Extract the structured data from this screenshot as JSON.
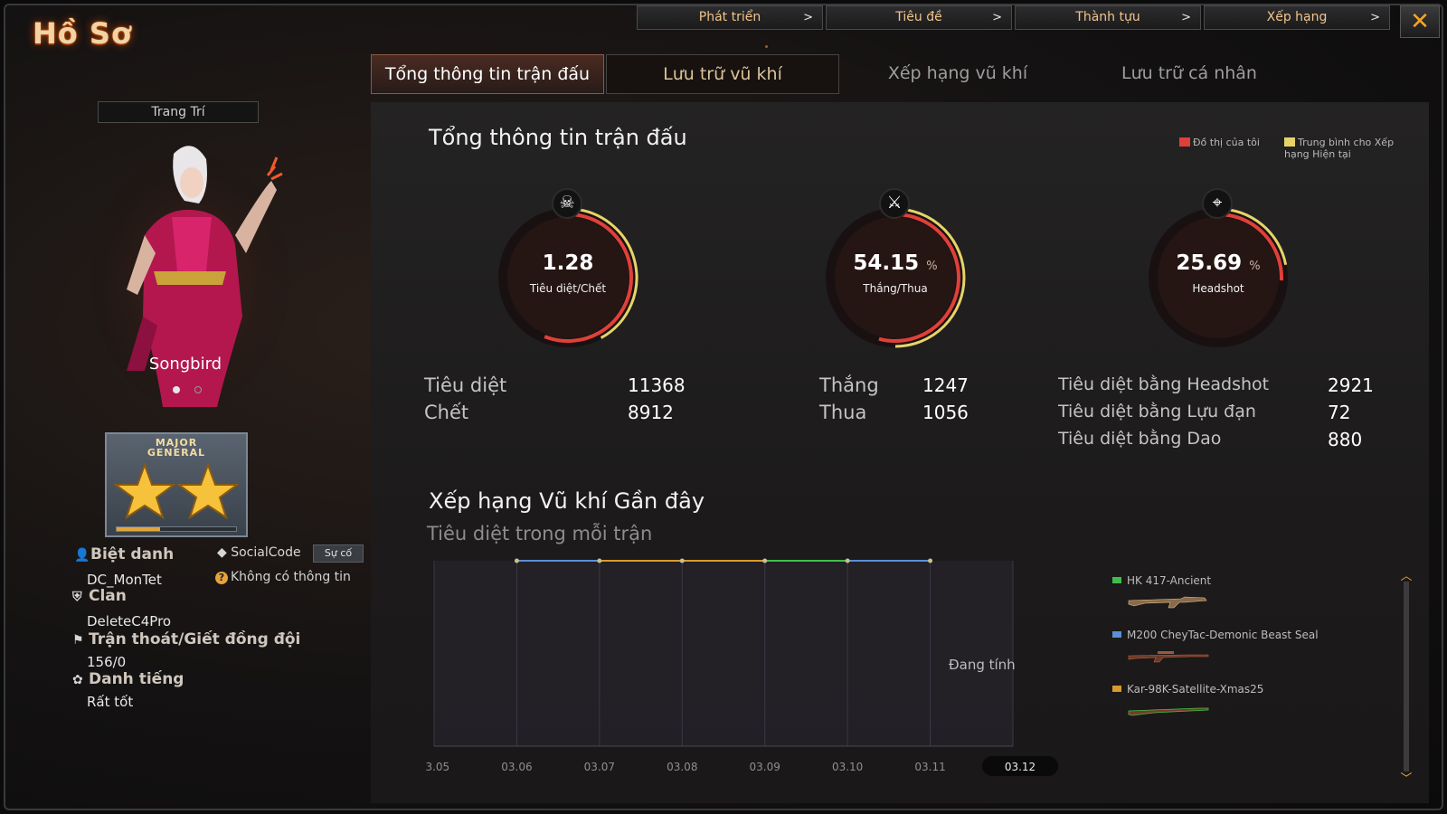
{
  "app": {
    "title": "Hồ Sơ"
  },
  "top_nav": [
    {
      "label": "Phát triển",
      "chevron": ">"
    },
    {
      "label": "Tiêu đề",
      "chevron": ">"
    },
    {
      "label": "Thành tựu",
      "chevron": ">"
    },
    {
      "label": "Xếp hạng",
      "chevron": ">"
    }
  ],
  "close_glyph": "✕",
  "tabs": [
    {
      "label": "Tổng thông tin trận đấu",
      "active": true
    },
    {
      "label": "Lưu trữ vũ khí",
      "active": false
    },
    {
      "label": "Xếp hạng vũ khí",
      "active": false
    },
    {
      "label": "Lưu trữ cá nhân",
      "active": false
    }
  ],
  "profile": {
    "decorate_label": "Trang Trí",
    "character_name": "Songbird",
    "rank_title": "MAJOR\nGENERAL",
    "rank_stars": 2,
    "rank_progress": 0.36,
    "nickname_label": "Biệt danh",
    "nickname": "DC_MonTet",
    "socialcode_label": "SocialCode",
    "incident_label": "Sự cố",
    "no_info_label": "Không có thông tin",
    "clan_label": "Clan",
    "clan": "DeleteC4Pro",
    "escape_label": "Trận thoát/Giết đồng đội",
    "escape_value": "156/0",
    "reputation_label": "Danh tiếng",
    "reputation_value": "Rất tốt"
  },
  "overview": {
    "title": "Tổng thông tin trận đấu",
    "legend_mine": "Đồ thị của tôi",
    "legend_avg": "Trung bình cho Xếp hạng Hiện tại",
    "legend_colors": {
      "mine": "#e0403a",
      "avg": "#e6d46a"
    },
    "gauges": [
      {
        "icon": "☠",
        "value": "1.28",
        "unit": "",
        "label": "Tiêu diệt/Chết",
        "mine_fraction": 0.56,
        "avg_fraction": 0.42
      },
      {
        "icon": "⚔",
        "value": "54.15",
        "unit": "%",
        "label": "Thắng/Thua",
        "mine_fraction": 0.5415,
        "avg_fraction": 0.5
      },
      {
        "icon": "⌖",
        "value": "25.69",
        "unit": "%",
        "label": "Headshot",
        "mine_fraction": 0.2569,
        "avg_fraction": 0.22
      }
    ],
    "stats": [
      {
        "label": "Tiêu diệt",
        "value": "11368"
      },
      {
        "label": "Chết",
        "value": "8912"
      },
      {
        "label": "Thắng",
        "value": "1247"
      },
      {
        "label": "Thua",
        "value": "1056"
      },
      {
        "label": "Tiêu diệt bằng Headshot",
        "value": "2921"
      },
      {
        "label": "Tiêu diệt bằng Lựu đạn",
        "value": "72"
      },
      {
        "label": "Tiêu diệt bằng Dao",
        "value": "880"
      }
    ]
  },
  "weapon_ranking": {
    "title": "Xếp hạng Vũ khí Gần đây",
    "subtitle": "Tiêu diệt trong mỗi trận",
    "calculating_label": "Đang tính",
    "weapons": [
      {
        "name": "HK 417-Ancient",
        "color": "#3fbf4a"
      },
      {
        "name": "M200 CheyTac-Demonic Beast Seal",
        "color": "#5a8fd8"
      },
      {
        "name": "Kar-98K-Satellite-Xmas25",
        "color": "#d99a2b"
      }
    ]
  },
  "chart_data": {
    "type": "line",
    "title": "Xếp hạng Vũ khí Gần đây",
    "ylabel": "Tiêu diệt trong mỗi trận",
    "categories": [
      "03.05",
      "03.06",
      "03.07",
      "03.08",
      "03.09",
      "03.10",
      "03.11",
      "03.12"
    ],
    "selected_category": "03.12",
    "series": [
      {
        "name": "HK 417-Ancient",
        "color": "#3fbf4a",
        "points": [
          [
            1,
            1
          ],
          [
            2,
            1
          ],
          [
            3,
            1
          ],
          [
            4,
            1
          ],
          [
            5,
            1
          ],
          [
            6,
            1
          ]
        ]
      },
      {
        "name": "M200 CheyTac-Demonic Beast Seal",
        "color": "#5a8fd8",
        "points": [
          [
            1,
            1
          ],
          [
            2,
            1
          ],
          [
            3,
            1
          ],
          [
            4,
            1
          ],
          [
            5,
            1
          ],
          [
            6,
            1
          ]
        ]
      },
      {
        "name": "Kar-98K-Satellite-Xmas25",
        "color": "#d99a2b",
        "points": [
          [
            1,
            1
          ],
          [
            2,
            1
          ],
          [
            3,
            1
          ],
          [
            4,
            1
          ],
          [
            5,
            1
          ],
          [
            6,
            1
          ]
        ]
      }
    ],
    "grid": true,
    "legend": "right"
  }
}
